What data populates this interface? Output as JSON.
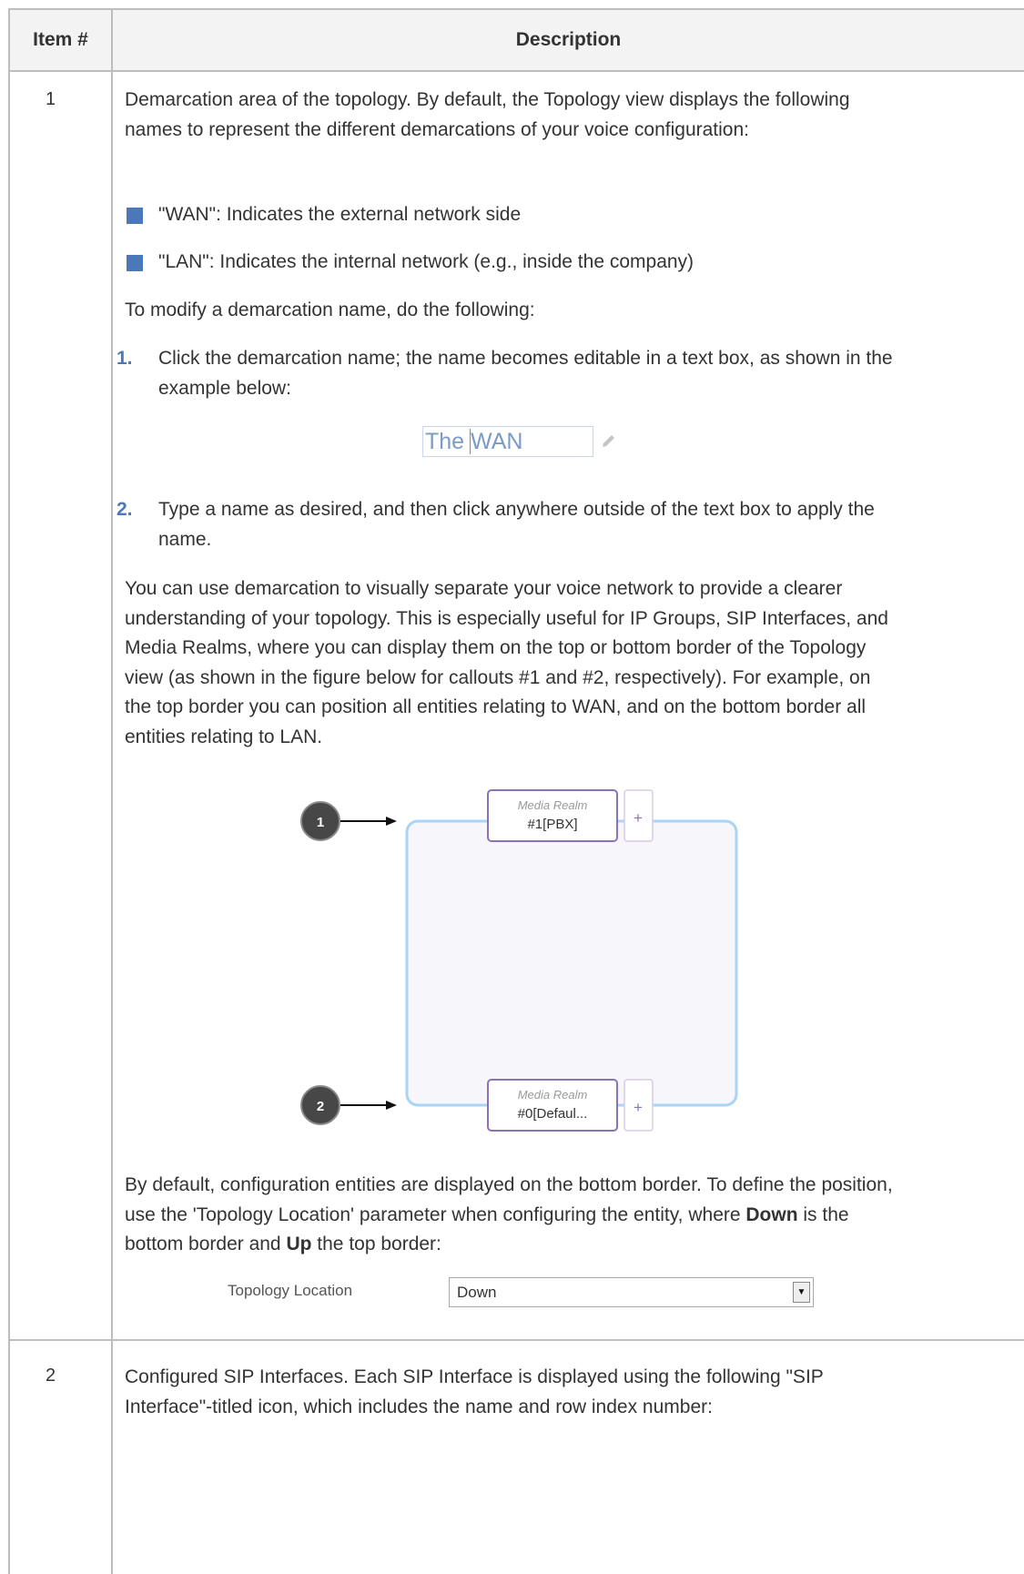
{
  "table": {
    "header": {
      "item": "Item #",
      "description": "Description"
    }
  },
  "row1": {
    "number": "1",
    "intro": "Demarcation area of the topology. By default, the Topology view displays the following names to represent the different demarcations of your voice configuration:",
    "bullets": [
      "\"WAN\": Indicates the external network side",
      "\"LAN\": Indicates the internal network (e.g., inside the company)"
    ],
    "modify_intro": "To modify a demarcation name, do the following:",
    "steps": [
      {
        "n": "1.",
        "text": "Click the demarcation name; the name becomes editable in a text box, as shown in the example below:"
      },
      {
        "n": "2.",
        "text": "Type a name as desired, and then click anywhere outside of the text box to apply the name."
      }
    ],
    "example_text": "The WAN",
    "usage": "You can use demarcation to visually separate your voice network to provide a clearer understanding of your topology. This is especially useful for IP Groups, SIP Interfaces, and Media Realms, where you can display them on the top or bottom border of the Topology view (as shown in the figure below for callouts #1 and #2, respectively). For example, on the top border you can position all entities relating to WAN, and on the bottom border all entities relating to LAN.",
    "figure": {
      "callout1": "1",
      "callout2": "2",
      "top_entity_title": "Media Realm",
      "top_entity_name": "#1[PBX]",
      "bottom_entity_title": "Media Realm",
      "bottom_entity_name": "#0[Defaul...",
      "plus": "+"
    },
    "default_pos_a": "By default, configuration entities are displayed on the bottom border. To define the position, use the 'Topology Location' parameter when configuring the entity, where ",
    "default_pos_down": "Down",
    "default_pos_b": " is the bottom border and ",
    "default_pos_up": "Up",
    "default_pos_c": " the top border:",
    "param_label": "Topology Location",
    "param_value": "Down"
  },
  "row2": {
    "number": "2",
    "text": "Configured SIP Interfaces. Each SIP Interface is displayed using the following \"SIP Interface\"-titled icon, which includes the name and row index number:"
  }
}
